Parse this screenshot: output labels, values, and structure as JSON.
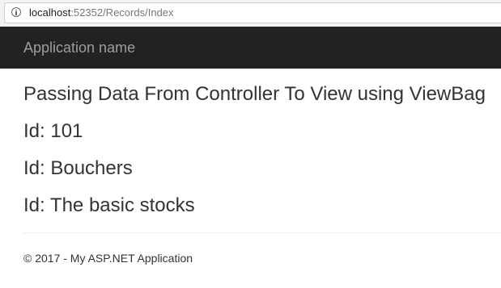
{
  "browser": {
    "url_host": "localhost",
    "url_path": ":52352/Records/Index",
    "info_icon": "info-icon"
  },
  "navbar": {
    "brand": "Application name"
  },
  "main": {
    "title": "Passing Data From Controller To View using ViewBag",
    "lines": [
      "Id: 101",
      "Id: Bouchers",
      "Id: The basic stocks"
    ]
  },
  "footer": {
    "text": "© 2017 - My ASP.NET Application"
  }
}
